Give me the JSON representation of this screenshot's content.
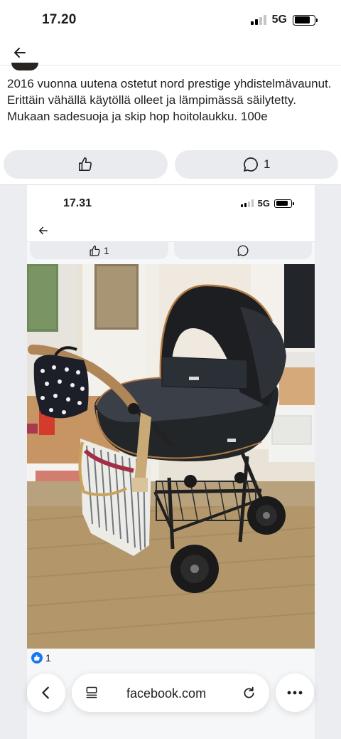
{
  "status_bar": {
    "time": "17.20",
    "network": "5G"
  },
  "post": {
    "text": "2016 vuonna uutena ostetut nord prestige yhdistelmävaunut. Erittäin vähällä käytöllä olleet ja lämpimässä säilytetty. Mukaan sadesuoja ja skip hop hoitolaukku. 100e",
    "comment_count": "1"
  },
  "screenshot": {
    "time": "17.31",
    "network": "5G",
    "like_count": "1",
    "reaction_count": "1"
  },
  "browser": {
    "url": "facebook.com"
  },
  "icons": {
    "back": "arrow-left-icon",
    "like": "thumbs-up-icon",
    "comment": "comment-bubble-icon",
    "reader": "reader-mode-icon",
    "reload": "reload-icon",
    "more": "more-dots-icon"
  },
  "colors": {
    "accent": "#1877f2",
    "button_bg": "#e9ebee"
  }
}
